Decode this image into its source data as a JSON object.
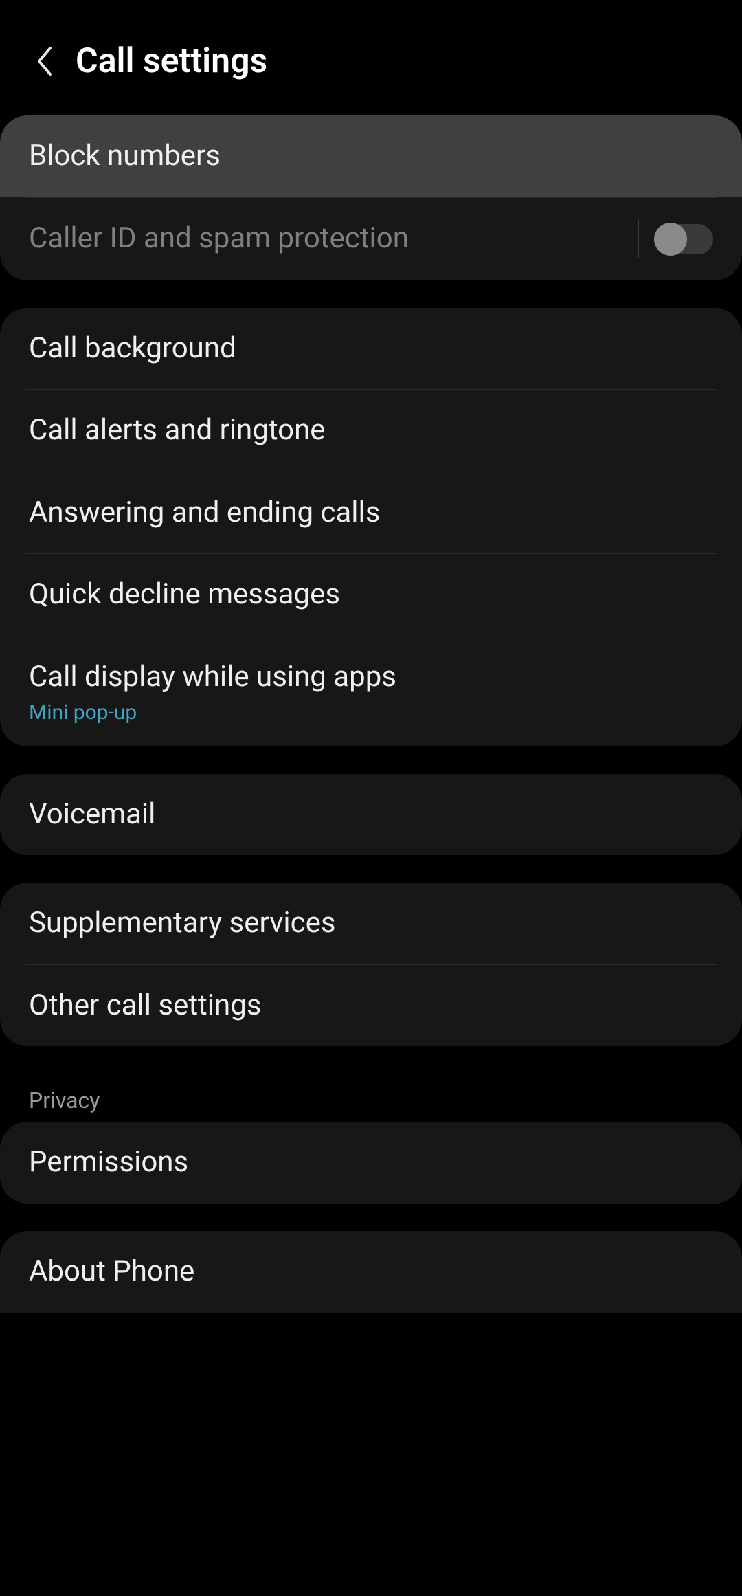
{
  "header": {
    "title": "Call settings"
  },
  "groups": [
    {
      "items": [
        {
          "label": "Block numbers",
          "highlighted": true
        },
        {
          "label": "Caller ID and spam protection",
          "disabled": true,
          "toggle": false
        }
      ]
    },
    {
      "items": [
        {
          "label": "Call background"
        },
        {
          "label": "Call alerts and ringtone"
        },
        {
          "label": "Answering and ending calls"
        },
        {
          "label": "Quick decline messages"
        },
        {
          "label": "Call display while using apps",
          "sublabel": "Mini pop-up"
        }
      ]
    },
    {
      "items": [
        {
          "label": "Voicemail"
        }
      ]
    },
    {
      "items": [
        {
          "label": "Supplementary services"
        },
        {
          "label": "Other call settings"
        }
      ]
    },
    {
      "section": "Privacy",
      "items": [
        {
          "label": "Permissions"
        }
      ]
    },
    {
      "items": [
        {
          "label": "About Phone"
        }
      ]
    }
  ]
}
